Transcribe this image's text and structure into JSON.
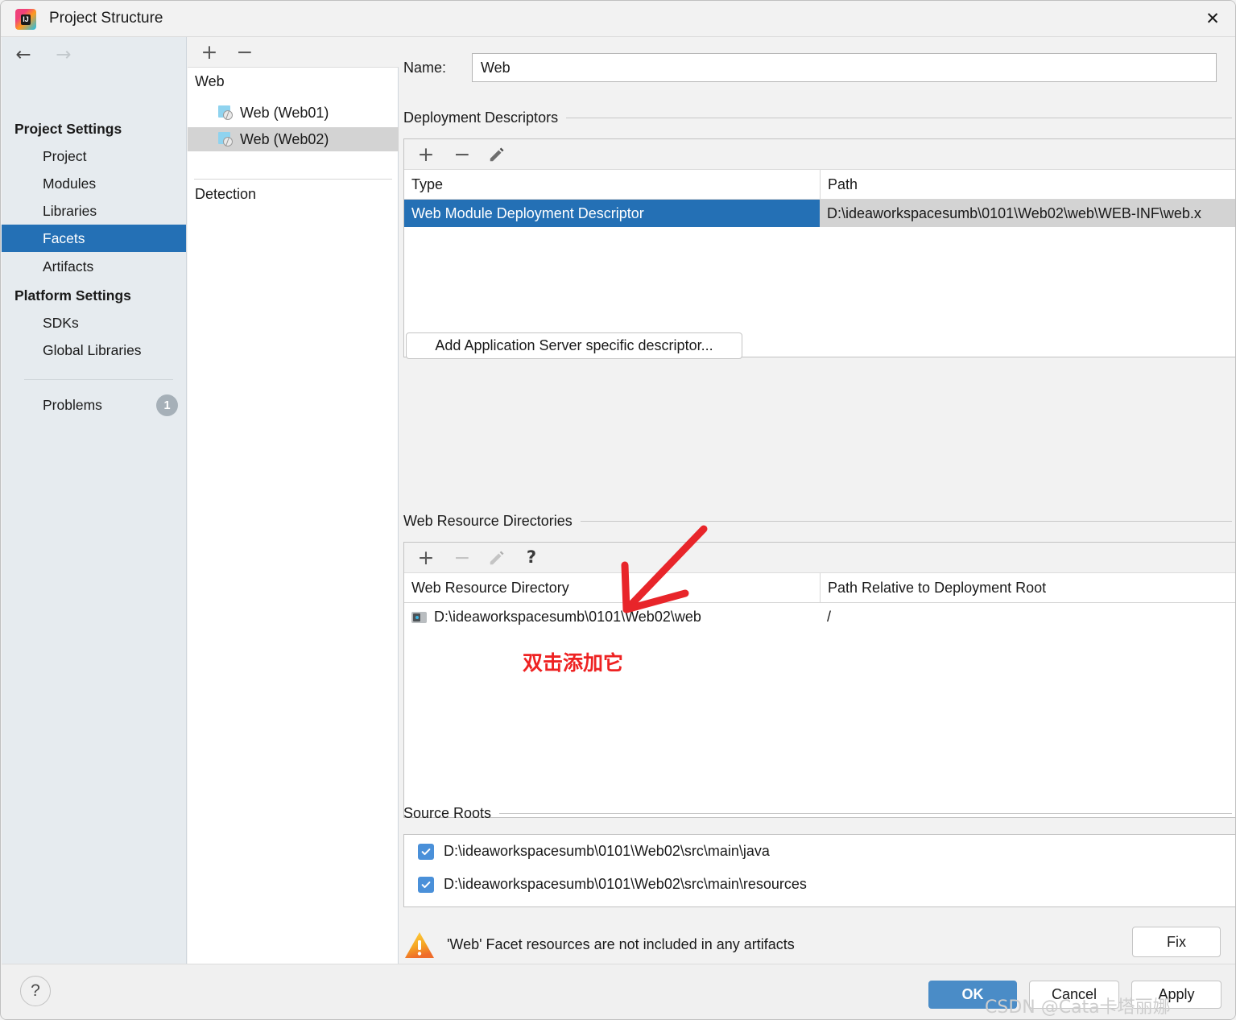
{
  "window": {
    "title": "Project Structure",
    "logo_text": "IJ",
    "close_label": "✕"
  },
  "sidebar": {
    "nav": {
      "back": "←",
      "forward": "→"
    },
    "groups": [
      {
        "label": "Project Settings",
        "items": [
          "Project",
          "Modules",
          "Libraries",
          "Facets",
          "Artifacts"
        ]
      },
      {
        "label": "Platform Settings",
        "items": [
          "SDKs",
          "Global Libraries"
        ]
      }
    ],
    "selected_item": "Facets",
    "problems": {
      "label": "Problems",
      "count": "1"
    }
  },
  "facet_panel": {
    "toolbar": {
      "add": "+",
      "remove": "−"
    },
    "group_label": "Web",
    "items": [
      {
        "label": "Web (Web01)",
        "selected": false
      },
      {
        "label": "Web (Web02)",
        "selected": true
      }
    ],
    "detection_label": "Detection"
  },
  "main": {
    "name_label": "Name:",
    "name_value": "Web",
    "deployment_descriptors": {
      "title": "Deployment Descriptors",
      "toolbar": {
        "add": "+",
        "remove": "−",
        "edit": "edit-pencil-icon"
      },
      "columns": [
        "Type",
        "Path"
      ],
      "rows": [
        {
          "type": "Web Module Deployment Descriptor",
          "path": "D:\\ideaworkspacesumb\\0101\\Web02\\web\\WEB-INF\\web.x",
          "selected": true
        }
      ],
      "add_descriptor_button": "Add Application Server specific descriptor..."
    },
    "web_resource_directories": {
      "title": "Web Resource Directories",
      "toolbar": {
        "add": "+",
        "remove": "−",
        "edit": "edit-pencil-icon",
        "help": "?"
      },
      "columns": [
        "Web Resource Directory",
        "Path Relative to Deployment Root"
      ],
      "rows": [
        {
          "directory": "D:\\ideaworkspacesumb\\0101\\Web02\\web",
          "relative_path": "/"
        }
      ]
    },
    "source_roots": {
      "title": "Source Roots",
      "items": [
        {
          "path": "D:\\ideaworkspacesumb\\0101\\Web02\\src\\main\\java",
          "checked": true
        },
        {
          "path": "D:\\ideaworkspacesumb\\0101\\Web02\\src\\main\\resources",
          "checked": true
        }
      ]
    },
    "warning": {
      "message": "'Web' Facet resources are not included in any artifacts",
      "fix_label": "Fix"
    }
  },
  "footer": {
    "help": "?",
    "ok": "OK",
    "cancel": "Cancel",
    "apply": "Apply"
  },
  "annotations": {
    "arrow": "red-arrow-pointing-to-web-resource-directory-row",
    "note_text": "双击添加它",
    "watermark": "CSDN @Cata卡塔丽娜"
  },
  "colors": {
    "selection_blue": "#2470b5",
    "accent_button": "#4a8cc7",
    "annotation_red": "#ee2222",
    "warning_orange": "#f5a623"
  }
}
